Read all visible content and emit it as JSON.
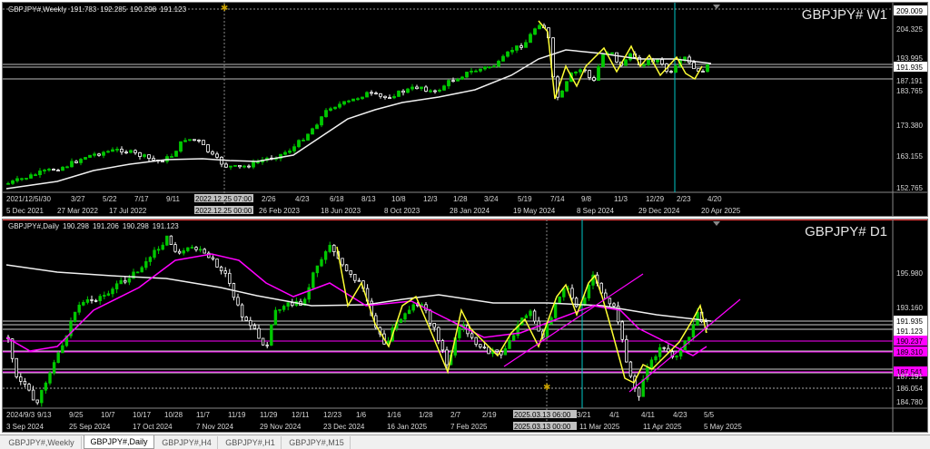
{
  "colors": {
    "background": "#000000",
    "candle_up": "#00c800",
    "candle_down": "#ffffff",
    "ma_white": "#f0f0f0",
    "ma_magenta": "#ff00ff",
    "zigzag": "#ffff33",
    "trendline": "#ff00ff",
    "vline_cyan": "#00c8c8",
    "price_label_bg": "#ff00ff"
  },
  "weekly": {
    "info": {
      "symbol": "GBPJPY#,Weekly",
      "open": "191.783",
      "high": "192.285",
      "low": "190.298",
      "close": "191.123"
    },
    "title": "GBPJPY# W1",
    "price_axis": [
      "209.009",
      "204.325",
      "193.995",
      "191.935",
      "187.191",
      "183.765",
      "173.380",
      "163.155",
      "152.765"
    ],
    "highlight_prices": {
      "current": "191.935",
      "top": "209.009"
    },
    "top_dates": [
      "2021/12/5I/30",
      "3/27",
      "5/22",
      "7/17",
      "9/11",
      "2022.12.25 07:00",
      "2/26",
      "4/23",
      "6/18",
      "8/13",
      "10/8",
      "12/3",
      "1/28",
      "3/24",
      "5/19",
      "7/14",
      "9/8",
      "11/3",
      "12/29",
      "2/23",
      "4/20"
    ],
    "bottom_dates": [
      "5 Dec 2021",
      "27 Mar 2022",
      "17 Jul 2022",
      "2022.12.25 00:00",
      "26 Feb 2023",
      "18 Jun 2023",
      "8 Oct 2023",
      "28 Jan 2024",
      "19 May 2024",
      "8 Sep 2024",
      "29 Dec 2024",
      "20 Apr 2025"
    ]
  },
  "daily": {
    "info": {
      "symbol": "GBPJPY#,Daily",
      "open": "190.298",
      "high": "191.206",
      "low": "190.298",
      "close": "191.123"
    },
    "title": "GBPJPY# D1",
    "price_axis": [
      "195.980",
      "193.160",
      "191.935",
      "191.123",
      "190.237",
      "189.310",
      "187.541",
      "187.191",
      "186.054",
      "184.780"
    ],
    "magenta_labels": [
      "190.237",
      "189.310",
      "187.541"
    ],
    "top_dates": [
      "2024/9/3",
      "9/13",
      "9/25",
      "10/7",
      "10/17",
      "10/28",
      "11/7",
      "11/19",
      "11/29",
      "12/11",
      "12/23",
      "1/6",
      "1/16",
      "1/28",
      "2/7",
      "2/19",
      "2025.03.13 06:00",
      "3/21",
      "4/1",
      "4/11",
      "4/23",
      "5/5"
    ],
    "bottom_dates": [
      "3 Sep 2024",
      "25 Sep 2024",
      "17 Oct 2024",
      "7 Nov 2024",
      "29 Nov 2024",
      "23 Dec 2024",
      "16 Jan 2025",
      "7 Feb 2025",
      "2025.03.13 00:00",
      "11 Mar 2025",
      "11 Apr 2025",
      "5 May 2025"
    ]
  },
  "tabs": [
    {
      "label": "GBPJPY#,Weekly",
      "active": false
    },
    {
      "label": "GBPJPY#,Daily",
      "active": true
    },
    {
      "label": "GBPJPY#,H4",
      "active": false
    },
    {
      "label": "GBPJPY#,H1",
      "active": false
    },
    {
      "label": "GBPJPY#,M15",
      "active": false
    }
  ]
}
